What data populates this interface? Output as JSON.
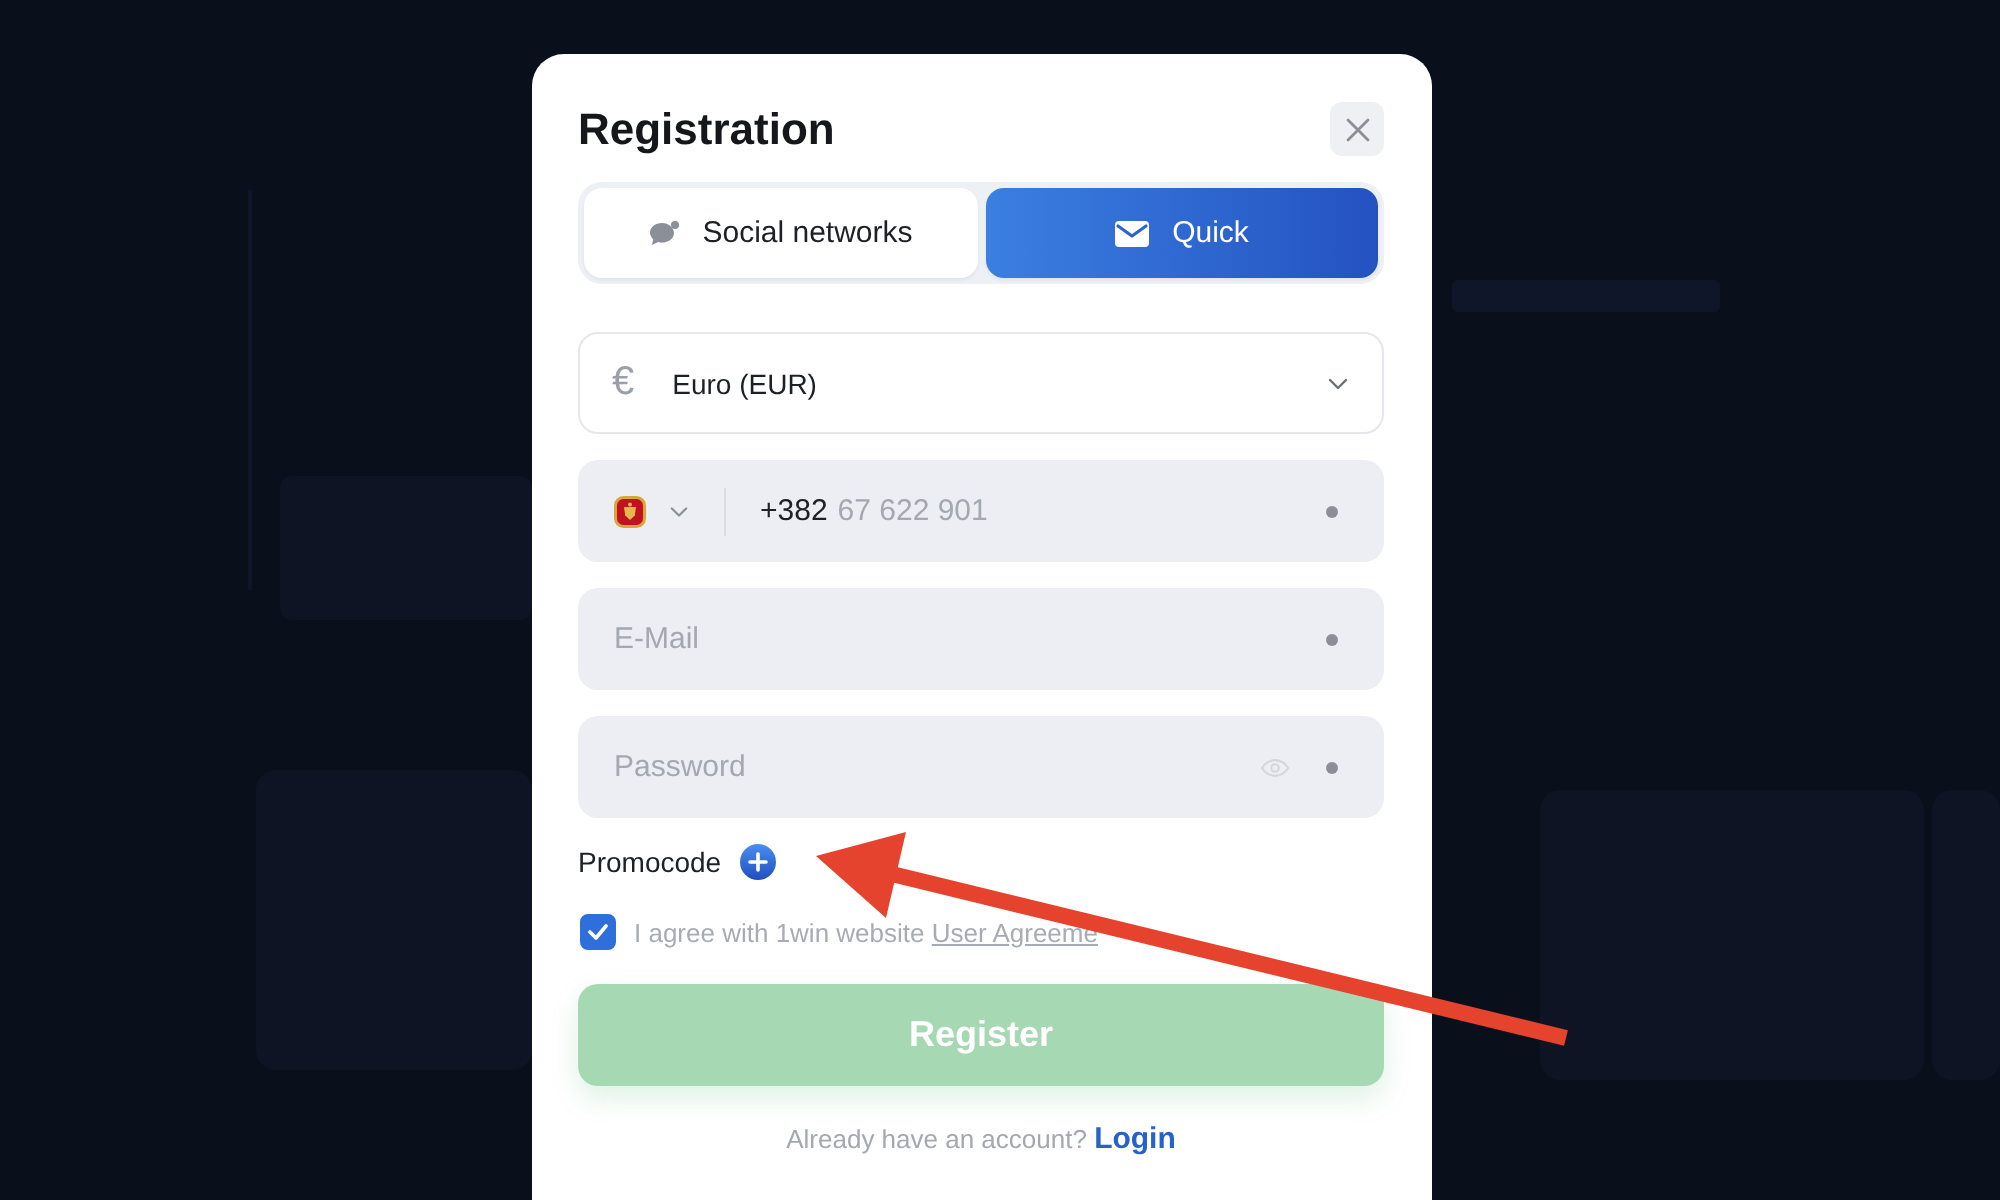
{
  "dialog": {
    "title": "Registration"
  },
  "tabs": [
    {
      "label": "Social networks",
      "selected": false
    },
    {
      "label": "Quick",
      "selected": true
    }
  ],
  "currency": {
    "symbol": "€",
    "value": "Euro (EUR)"
  },
  "fields": [
    {
      "kind": "phone",
      "dial_code": "+382",
      "placeholder": "67 622 901",
      "required": true
    },
    {
      "kind": "email",
      "placeholder": "E-Mail",
      "required": true
    },
    {
      "kind": "password",
      "placeholder": "Password",
      "required": true
    }
  ],
  "promocode": {
    "label": "Promocode"
  },
  "agreement": {
    "checked": true,
    "text": "I agree with 1win website",
    "link": "User Agreeme"
  },
  "register_button": {
    "label": "Register",
    "disabled": true
  },
  "login_prompt": {
    "text": "Already have an account?",
    "link": "Login"
  }
}
